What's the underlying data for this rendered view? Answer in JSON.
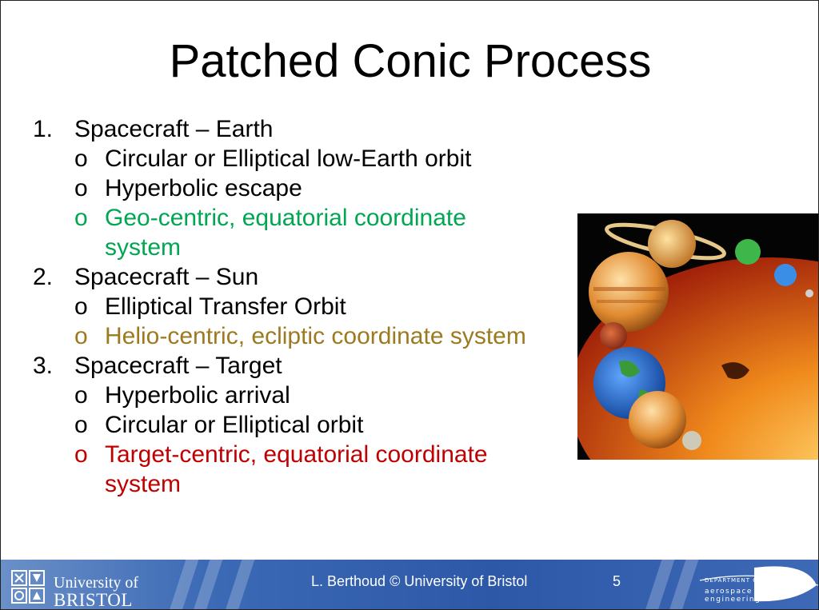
{
  "slide": {
    "title": "Patched Conic Process",
    "items": [
      {
        "number": "1.",
        "label": "Spacecraft – Earth",
        "subitems": [
          {
            "text": "Circular or Elliptical low-Earth orbit"
          },
          {
            "text": "Hyperbolic escape"
          },
          {
            "text": "Geo-centric, equatorial coordinate",
            "text2": "system",
            "color": "#00a651"
          }
        ]
      },
      {
        "number": "2.",
        "label": "Spacecraft – Sun",
        "subitems": [
          {
            "text": "Elliptical Transfer Orbit"
          },
          {
            "text": "Helio-centric, ecliptic coordinate system",
            "color": "#9c7a1f"
          }
        ]
      },
      {
        "number": "3.",
        "label": "Spacecraft – Target",
        "subitems": [
          {
            "text": "Hyperbolic arrival"
          },
          {
            "text": "Circular or Elliptical orbit"
          },
          {
            "text": "Target-centric, equatorial coordinate",
            "text2": "system",
            "color": "#c00000"
          }
        ]
      }
    ],
    "bullet": "o"
  },
  "image": {
    "icon": "solar-system-planets-image"
  },
  "footer": {
    "university_line1": "University of",
    "university_line2": "BRISTOL",
    "credit": "L. Berthoud © University of Bristol",
    "page": "5",
    "dept_line1": "DEPARTMENT OF",
    "dept_line2": "aerospace",
    "dept_line3": "engineering"
  }
}
